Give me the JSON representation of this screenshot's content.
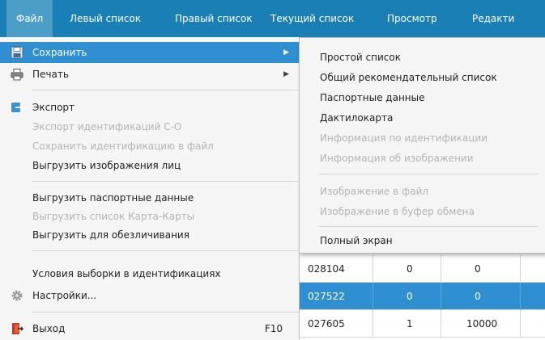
{
  "menubar": {
    "items": [
      {
        "label": "Файл",
        "active": true
      },
      {
        "label": "Левый список"
      },
      {
        "label": "Правый список"
      },
      {
        "label": "Текущий список"
      },
      {
        "label": "Просмотр"
      },
      {
        "label": "Редакти"
      }
    ]
  },
  "file_menu": {
    "save": "Сохранить",
    "print": "Печать",
    "export": "Экспорт",
    "export_ids": "Экспорт идентификаций С-О",
    "save_id_file": "Сохранить идентификацию в файл",
    "unload_faces": "Выгрузить изображения лиц",
    "unload_passport": "Выгрузить паспортные данные",
    "unload_card_list": "Выгрузить список Карта-Карты",
    "unload_anon": "Выгрузить для обезличивания",
    "selection_conditions": "Условия выборки в идентификациях",
    "settings": "Настройки...",
    "exit": "Выход",
    "exit_shortcut": "F10"
  },
  "save_submenu": {
    "simple_list": "Простой список",
    "common_rec_list": "Общий рекомендательный список",
    "passport_data": "Паспортные данные",
    "fingerprint_card": "Дактилокарта",
    "id_info": "Информация по идентификации",
    "image_info": "Информация об изображении",
    "image_to_file": "Изображение в файл",
    "image_to_clipboard": "Изображение в буфер обмена",
    "full_screen": "Полный экран"
  },
  "table": {
    "rows": [
      {
        "id": "028104",
        "c2": "0",
        "c3": "0",
        "selected": false
      },
      {
        "id": "027522",
        "c2": "0",
        "c3": "0",
        "selected": true
      },
      {
        "id": "027605",
        "c2": "1",
        "c3": "10000",
        "selected": false
      }
    ]
  },
  "colors": {
    "menubar": "#1a7fb5",
    "highlight": "#2f8fd0",
    "menu_bg": "#f5f5f5",
    "disabled_text": "#b4b4b4"
  }
}
